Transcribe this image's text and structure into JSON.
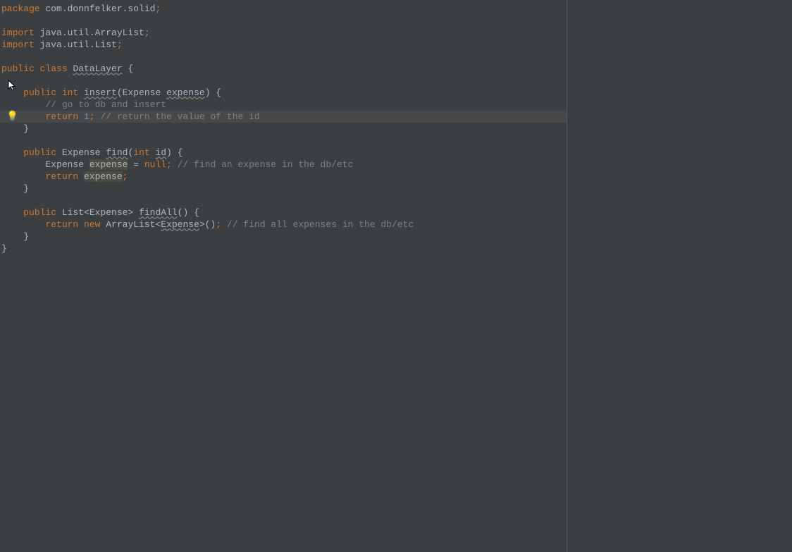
{
  "file": "DataLayer.java",
  "colors": {
    "background": "#3c3f41",
    "keyword": "#cc7832",
    "default": "#a9b7c6",
    "comment": "#808080",
    "number": "#6897bb",
    "currentLine": "#46484a",
    "usage": "#4b4b3f"
  },
  "icons": {
    "intentionBulb": "bulb-icon",
    "cursor": "mouse-cursor-icon"
  },
  "currentLineIndex": 9,
  "code": {
    "lines": [
      {
        "i": 0,
        "segments": [
          {
            "t": "package",
            "c": "kw-pkg"
          },
          {
            "t": " com.donnfelker.solid",
            "c": "ident"
          },
          {
            "t": ";",
            "c": "kw"
          }
        ]
      },
      {
        "i": 1,
        "segments": []
      },
      {
        "i": 2,
        "segments": [
          {
            "t": "import",
            "c": "kw"
          },
          {
            "t": " java.util.ArrayList",
            "c": "ident"
          },
          {
            "t": ";",
            "c": "kw"
          }
        ]
      },
      {
        "i": 3,
        "segments": [
          {
            "t": "import",
            "c": "kw"
          },
          {
            "t": " java.util.List",
            "c": "ident"
          },
          {
            "t": ";",
            "c": "kw"
          }
        ]
      },
      {
        "i": 4,
        "segments": []
      },
      {
        "i": 5,
        "segments": [
          {
            "t": "public class",
            "c": "kw"
          },
          {
            "t": " ",
            "c": "ident"
          },
          {
            "t": "DataLayer",
            "c": "warn"
          },
          {
            "t": " {",
            "c": "ident"
          }
        ]
      },
      {
        "i": 6,
        "segments": []
      },
      {
        "i": 7,
        "segments": [
          {
            "t": "    ",
            "c": "ident"
          },
          {
            "t": "public int",
            "c": "kw"
          },
          {
            "t": " ",
            "c": "ident"
          },
          {
            "t": "insert",
            "c": "warn"
          },
          {
            "t": "(Expense ",
            "c": "ident"
          },
          {
            "t": "expense",
            "c": "warn"
          },
          {
            "t": ") {",
            "c": "ident"
          }
        ]
      },
      {
        "i": 8,
        "segments": [
          {
            "t": "        ",
            "c": "ident"
          },
          {
            "t": "// go to db and insert",
            "c": "comment"
          }
        ]
      },
      {
        "i": 9,
        "hl": true,
        "segments": [
          {
            "t": "        ",
            "c": "ident"
          },
          {
            "t": "return ",
            "c": "kw"
          },
          {
            "t": "1",
            "c": "num"
          },
          {
            "t": ";",
            "c": "kw"
          },
          {
            "t": " ",
            "c": "ident"
          },
          {
            "t": "// return the value of the id",
            "c": "comment"
          }
        ]
      },
      {
        "i": 10,
        "segments": [
          {
            "t": "    }",
            "c": "ident"
          }
        ]
      },
      {
        "i": 11,
        "segments": []
      },
      {
        "i": 12,
        "segments": [
          {
            "t": "    ",
            "c": "ident"
          },
          {
            "t": "public",
            "c": "kw"
          },
          {
            "t": " Expense ",
            "c": "ident"
          },
          {
            "t": "find",
            "c": "warn"
          },
          {
            "t": "(",
            "c": "ident"
          },
          {
            "t": "int",
            "c": "kw"
          },
          {
            "t": " ",
            "c": "ident"
          },
          {
            "t": "id",
            "c": "warn"
          },
          {
            "t": ") {",
            "c": "ident"
          }
        ]
      },
      {
        "i": 13,
        "segments": [
          {
            "t": "        Expense ",
            "c": "ident"
          },
          {
            "t": "expense",
            "c": "ident",
            "u": true
          },
          {
            "t": " = ",
            "c": "ident"
          },
          {
            "t": "null",
            "c": "null"
          },
          {
            "t": ";",
            "c": "kw"
          },
          {
            "t": " ",
            "c": "ident"
          },
          {
            "t": "// find an expense in the db/etc",
            "c": "comment"
          }
        ]
      },
      {
        "i": 14,
        "segments": [
          {
            "t": "        ",
            "c": "ident"
          },
          {
            "t": "return ",
            "c": "kw"
          },
          {
            "t": "expense",
            "c": "ident",
            "u": true
          },
          {
            "t": ";",
            "c": "kw"
          }
        ]
      },
      {
        "i": 15,
        "segments": [
          {
            "t": "    }",
            "c": "ident"
          }
        ]
      },
      {
        "i": 16,
        "segments": []
      },
      {
        "i": 17,
        "segments": [
          {
            "t": "    ",
            "c": "ident"
          },
          {
            "t": "public",
            "c": "kw"
          },
          {
            "t": " List<Expense> ",
            "c": "ident"
          },
          {
            "t": "findAll",
            "c": "warn"
          },
          {
            "t": "() {",
            "c": "ident"
          }
        ]
      },
      {
        "i": 18,
        "segments": [
          {
            "t": "        ",
            "c": "ident"
          },
          {
            "t": "return new ",
            "c": "kw"
          },
          {
            "t": "ArrayList<",
            "c": "ident"
          },
          {
            "t": "Expense",
            "c": "warn"
          },
          {
            "t": ">()",
            "c": "ident"
          },
          {
            "t": ";",
            "c": "kw"
          },
          {
            "t": " ",
            "c": "ident"
          },
          {
            "t": "// find all expenses in the db/etc",
            "c": "comment"
          }
        ]
      },
      {
        "i": 19,
        "segments": [
          {
            "t": "    }",
            "c": "ident"
          }
        ]
      },
      {
        "i": 20,
        "segments": [
          {
            "t": "}",
            "c": "ident"
          }
        ]
      }
    ]
  }
}
